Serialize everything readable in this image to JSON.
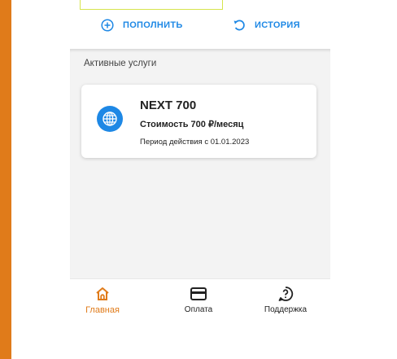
{
  "actions": {
    "topup_label": "ПОПОЛНИТЬ",
    "topup_icon": "plus-circle-icon",
    "history_label": "ИСТОРИЯ",
    "history_icon": "history-icon"
  },
  "active_services": {
    "section_title": "Активные услуги",
    "items": [
      {
        "name": "NEXT 700",
        "price": "Стоимость 700 ₽/месяц",
        "period": "Период действия с 01.01.2023",
        "icon": "globe-icon"
      }
    ]
  },
  "bottom_nav": {
    "items": [
      {
        "label": "Главная",
        "icon": "home-icon",
        "active": true
      },
      {
        "label": "Оплата",
        "icon": "card-icon",
        "active": false
      },
      {
        "label": "Поддержка",
        "icon": "help-icon",
        "active": false
      }
    ]
  },
  "colors": {
    "accent_blue": "#1e88e5",
    "accent_orange": "#e07b1a",
    "highlight_box": "#d6e44c"
  }
}
